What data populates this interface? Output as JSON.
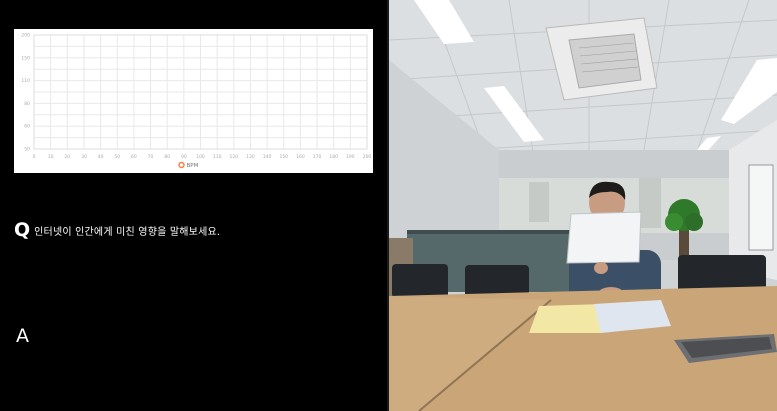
{
  "question": {
    "marker": "Q",
    "text": "인터넷이 인간에게 미친 영향을 말해보세요."
  },
  "answer": {
    "marker": "A"
  },
  "chart_data": {
    "type": "line",
    "x": [
      0,
      10,
      20,
      30,
      40,
      50,
      60,
      70,
      80,
      90,
      100,
      110,
      120,
      130,
      140,
      150,
      160,
      170,
      180,
      190,
      200
    ],
    "x_ticks": [
      "0",
      "10",
      "20",
      "30",
      "40",
      "50",
      "60",
      "70",
      "80",
      "90",
      "100",
      "110",
      "120",
      "130",
      "140",
      "150",
      "160",
      "170",
      "180",
      "190",
      "200"
    ],
    "y_ticks": [
      "200",
      "150",
      "110",
      "80",
      "60",
      "50"
    ],
    "series": [
      {
        "name": "BPM",
        "values": []
      }
    ],
    "legend_position": "bottom",
    "grid": true,
    "colors": {
      "series": "#ff7a3d",
      "grid": "#e8e8e8",
      "tick": "#aaaaaa"
    }
  }
}
